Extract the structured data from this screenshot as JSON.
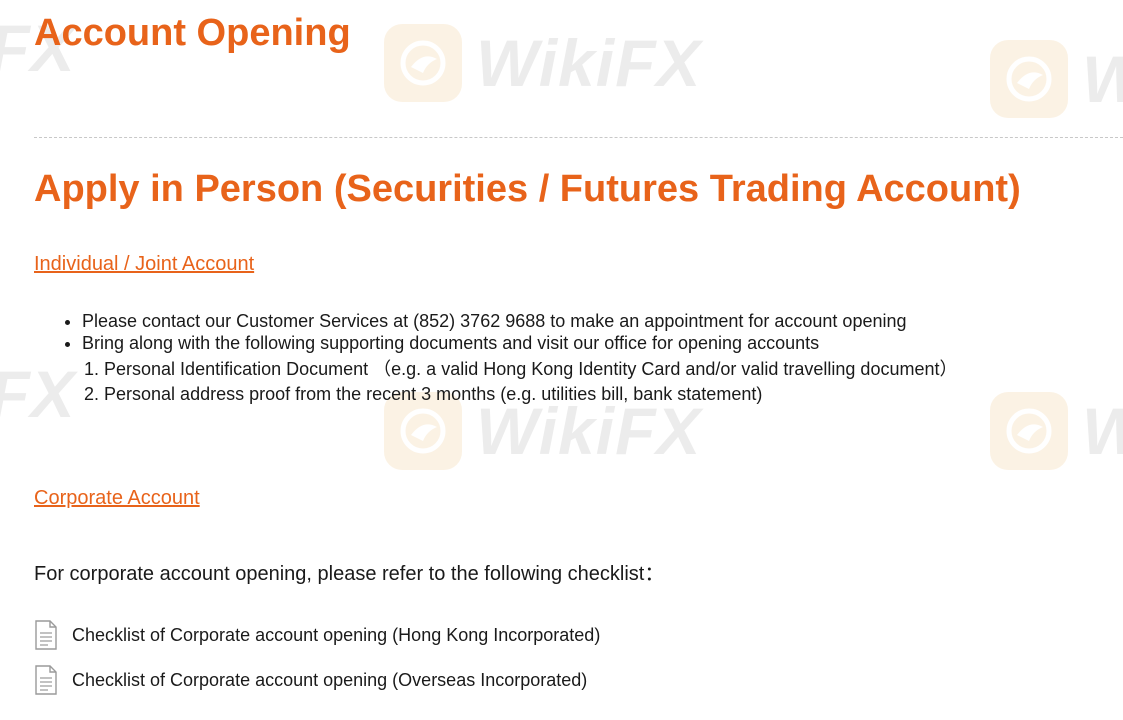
{
  "header": {
    "title": "Account Opening"
  },
  "watermark": {
    "text": "WikiFX",
    "partial_text": "iFX",
    "logo_icon": "eagle-logo-icon",
    "color": "#e8a23a"
  },
  "main": {
    "title": "Apply in Person (Securities / Futures Trading Account)",
    "individual": {
      "link_label": "Individual / Joint Account",
      "bullets": [
        "Please contact our Customer Services at (852) 3762 9688 to make an appointment for account opening",
        "Bring along with the following supporting documents and visit our office for opening accounts"
      ],
      "documents": [
        "1. Personal Identification Document （e.g. a valid Hong Kong Identity Card and/or valid travelling document）",
        "2. Personal address proof from the recent 3 months (e.g. utilities bill, bank statement)"
      ]
    },
    "corporate": {
      "link_label": "Corporate Account",
      "intro": "For corporate account opening, please refer to the following checklist：",
      "checklists": [
        {
          "label": "Checklist of Corporate account opening (Hong Kong Incorporated)",
          "icon": "document-icon"
        },
        {
          "label": "Checklist of Corporate account opening (Overseas Incorporated)",
          "icon": "document-icon"
        }
      ]
    }
  },
  "colors": {
    "accent": "#e8631a",
    "text": "#1a1a1a",
    "divider": "#c8c8c8"
  }
}
